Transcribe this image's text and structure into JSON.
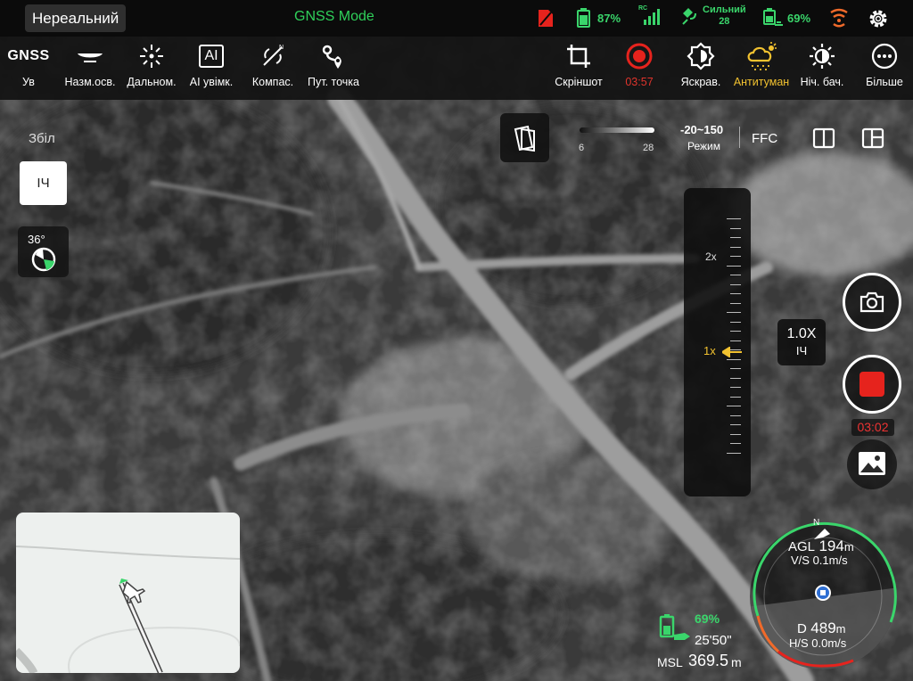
{
  "status_bar": {
    "mode": "Нереальний",
    "gnss_mode": "GNSS Mode",
    "aircraft_battery": "87%",
    "rc_label": "RC",
    "signal_label": "Сильний",
    "signal_count": "28",
    "rc_battery": "69%"
  },
  "toolbar": {
    "gnss": {
      "icon_text": "GNSS",
      "label": "Ув"
    },
    "ground_light": "Назм.осв.",
    "rangefinder": "Дальном.",
    "ai": {
      "icon_text": "AI",
      "label": "AI увімк."
    },
    "compass": "Компас.",
    "waypoint": "Пут. точка",
    "screenshot": "Скріншот",
    "record_time": "03:57",
    "brightness": "Яскрав.",
    "defog": "Антитуман",
    "night_vision": "Ніч. бач.",
    "more": "Більше"
  },
  "left_panel": {
    "zoom_label": "Збіл",
    "ir_button": "ІЧ",
    "compass_degrees": "36°"
  },
  "thermal": {
    "palette_min": "6",
    "palette_max": "28",
    "range": "-20~150",
    "range_label": "Режим",
    "ffc": "FFC"
  },
  "zoom_slider": {
    "label_2x": "2x",
    "label_1x": "1x"
  },
  "zoom_badge": {
    "value": "1.0X",
    "mode": "ІЧ"
  },
  "capture": {
    "record_time": "03:02"
  },
  "flight": {
    "rc_battery": "69%",
    "rc_time": "25'50\"",
    "msl_label": "MSL",
    "msl_value": "369.5",
    "msl_unit": "m",
    "agl_label": "AGL",
    "agl_value": "194",
    "agl_unit": "m",
    "vs": "V/S 0.1m/s",
    "d_label": "D",
    "d_value": "489",
    "d_unit": "m",
    "hs": "H/S 0.0m/s",
    "north": "N"
  },
  "colors": {
    "accent_green": "#3ad56b",
    "record_red": "#e6231d",
    "highlight_yellow": "#f2c230"
  }
}
